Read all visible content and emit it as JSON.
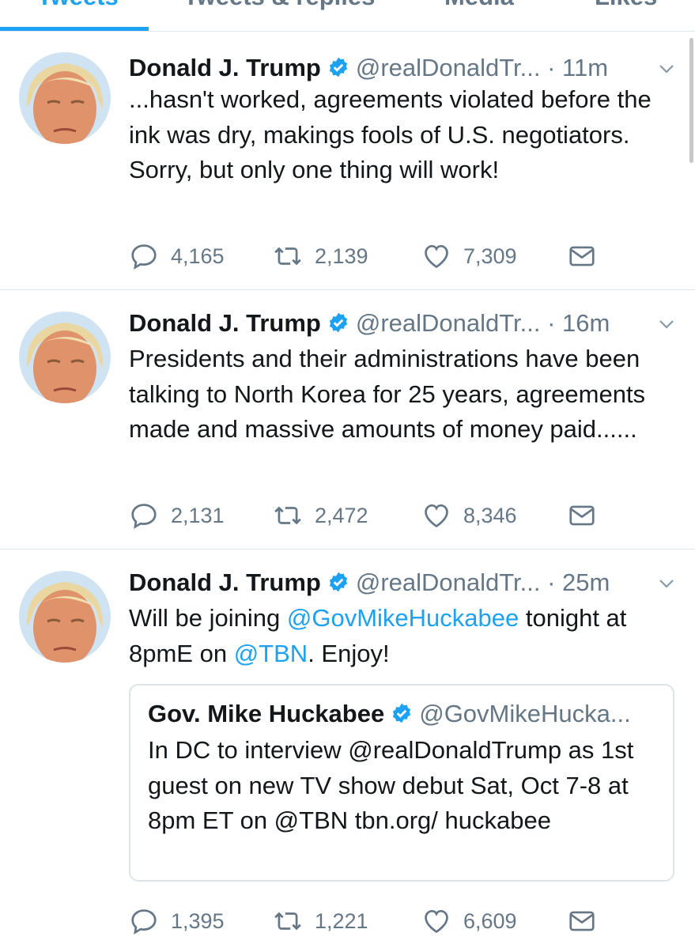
{
  "tabs": [
    {
      "label": "Tweets",
      "active": true
    },
    {
      "label": "Tweets & replies",
      "active": false
    },
    {
      "label": "Media",
      "active": false
    },
    {
      "label": "Likes",
      "active": false
    }
  ],
  "colors": {
    "accent": "#1da1f2",
    "secondary_text": "#657786",
    "primary_text": "#14171a",
    "divider": "#e1e8ed"
  },
  "tweets": [
    {
      "name": "Donald J. Trump",
      "handle": "@realDonaldTr...",
      "time": "· 11m",
      "text": "...hasn't worked, agreements violated before the ink was dry, makings fools of U.S. negotiators. Sorry, but only one thing will work!",
      "replies": "4,165",
      "retweets": "2,139",
      "likes": "7,309"
    },
    {
      "name": "Donald J. Trump",
      "handle": "@realDonaldTr...",
      "time": "· 16m",
      "text": "Presidents and their administrations have been talking to North Korea for 25 years, agreements made and massive amounts of money paid......",
      "replies": "2,131",
      "retweets": "2,472",
      "likes": "8,346"
    },
    {
      "name": "Donald J. Trump",
      "handle": "@realDonaldTr...",
      "time": "· 25m",
      "text_parts": [
        "Will be joining ",
        "@GovMikeHuckabee",
        " tonight at 8pmE on ",
        "@TBN",
        ". Enjoy!"
      ],
      "quote": {
        "name": "Gov. Mike Huckabee",
        "handle": "@GovMikeHucka...",
        "text": "In DC to interview @realDonaldTrump as 1st guest on new TV show debut Sat, Oct 7-8 at 8pm ET on @TBN  tbn.org/ huckabee"
      },
      "replies": "1,395",
      "retweets": "1,221",
      "likes": "6,609"
    }
  ],
  "icons": {
    "verified": "verified-badge-icon",
    "caret": "chevron-down-icon",
    "reply": "reply-icon",
    "retweet": "retweet-icon",
    "like": "heart-icon",
    "dm": "envelope-icon"
  }
}
